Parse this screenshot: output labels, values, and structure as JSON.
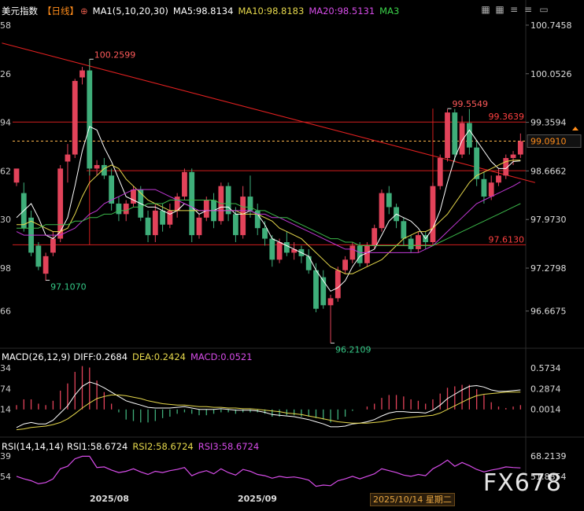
{
  "header": {
    "symbol": "美元指数",
    "period": "【日线】",
    "ma_label": "MA1(5,10,20,30)",
    "ma5": "MA5:98.8134",
    "ma10": "MA10:98.8183",
    "ma20": "MA20:98.5131",
    "ma3": "MA3"
  },
  "macd_header": {
    "label": "MACD(26,12,9)",
    "diff": "DIFF:0.2684",
    "dea": "DEA:0.2424",
    "macd": "MACD:0.0521"
  },
  "rsi_header": {
    "label": "RSI(14,14,14)",
    "rsi1": "RSI1:58.6724",
    "rsi2": "RSI2:58.6724",
    "rsi3": "RSI3:58.6724"
  },
  "colors": {
    "up": "#e2435a",
    "down": "#3fae7a",
    "ma5": "#ffffff",
    "ma10": "#e6d84c",
    "ma20": "#c238d6",
    "ma30": "#3bb84a",
    "hline": "#d31e1e",
    "price": "#ffb84d"
  },
  "toolbar": {
    "icons": [
      "grid-icon",
      "grid-icon",
      "menu-icon",
      "menu-icon",
      "minimize-icon"
    ]
  },
  "watermark": "FX678",
  "x_labels": [
    "2025/08",
    "2025/09"
  ],
  "date_badge": "2025/10/14 星期二",
  "chart_data": {
    "type": "candlestick",
    "price_axis": {
      "ticks": [
        100.7458,
        100.0526,
        99.3594,
        98.6662,
        97.973,
        97.2798,
        96.6675
      ],
      "left_ticks": [
        "58",
        "26",
        "94",
        "62",
        "30",
        "98",
        "66"
      ],
      "ylim": [
        96.17,
        100.88
      ],
      "current_price": 99.091,
      "current_label": "99.0910",
      "markers": [
        "99.3639",
        "97.6130"
      ],
      "marker_values": [
        99.3639,
        97.613
      ],
      "extra_line": 98.67
    },
    "annotations": [
      {
        "label": "100.2599",
        "bar": 10,
        "price": 100.2599
      },
      {
        "label": "97.1070",
        "bar": 4,
        "price": 97.107
      },
      {
        "label": "96.2109",
        "bar": 43,
        "price": 96.2109
      },
      {
        "label": "99.5549",
        "bar": 59,
        "price": 99.5549
      }
    ],
    "trendline": [
      {
        "bar": -2,
        "price": 100.49
      },
      {
        "bar": 71,
        "price": 98.5
      }
    ],
    "candles": [
      {
        "o": 98.5,
        "h": 98.68,
        "c": 98.7,
        "l": 98.45
      },
      {
        "o": 98.35,
        "h": 98.5,
        "c": 97.85,
        "l": 97.8
      },
      {
        "o": 98.0,
        "h": 98.1,
        "c": 97.5,
        "l": 97.45
      },
      {
        "o": 97.6,
        "h": 97.65,
        "c": 97.3,
        "l": 97.25
      },
      {
        "o": 97.2,
        "h": 97.5,
        "c": 97.45,
        "l": 97.1
      },
      {
        "o": 97.5,
        "h": 97.8,
        "c": 97.7,
        "l": 97.45
      },
      {
        "o": 97.7,
        "h": 98.75,
        "c": 98.7,
        "l": 97.65
      },
      {
        "o": 98.8,
        "h": 99.05,
        "c": 98.9,
        "l": 98.5
      },
      {
        "o": 98.9,
        "h": 99.98,
        "c": 99.95,
        "l": 98.85
      },
      {
        "o": 100.0,
        "h": 100.15,
        "c": 100.1,
        "l": 99.9
      },
      {
        "o": 100.1,
        "h": 100.26,
        "c": 98.7,
        "l": 98.6
      },
      {
        "o": 98.7,
        "h": 98.82,
        "c": 98.75,
        "l": 98.6
      },
      {
        "o": 98.75,
        "h": 98.85,
        "c": 98.6,
        "l": 98.55
      },
      {
        "o": 98.6,
        "h": 98.7,
        "c": 98.2,
        "l": 98.1
      },
      {
        "o": 98.2,
        "h": 98.3,
        "c": 98.05,
        "l": 97.95
      },
      {
        "o": 98.05,
        "h": 98.25,
        "c": 98.2,
        "l": 97.95
      },
      {
        "o": 98.2,
        "h": 98.45,
        "c": 98.4,
        "l": 98.15
      },
      {
        "o": 98.4,
        "h": 98.45,
        "c": 98.0,
        "l": 97.95
      },
      {
        "o": 98.0,
        "h": 98.1,
        "c": 97.75,
        "l": 97.65
      },
      {
        "o": 97.75,
        "h": 98.2,
        "c": 98.1,
        "l": 97.65
      },
      {
        "o": 98.1,
        "h": 98.2,
        "c": 97.9,
        "l": 97.8
      },
      {
        "o": 97.9,
        "h": 98.2,
        "c": 98.1,
        "l": 97.85
      },
      {
        "o": 98.1,
        "h": 98.35,
        "c": 98.3,
        "l": 98.0
      },
      {
        "o": 98.3,
        "h": 98.7,
        "c": 98.65,
        "l": 98.25
      },
      {
        "o": 98.65,
        "h": 98.7,
        "c": 97.75,
        "l": 97.65
      },
      {
        "o": 97.75,
        "h": 98.05,
        "c": 98.0,
        "l": 97.7
      },
      {
        "o": 98.0,
        "h": 98.3,
        "c": 98.25,
        "l": 97.95
      },
      {
        "o": 98.25,
        "h": 98.35,
        "c": 97.95,
        "l": 97.85
      },
      {
        "o": 97.95,
        "h": 98.5,
        "c": 98.45,
        "l": 97.9
      },
      {
        "o": 98.45,
        "h": 98.5,
        "c": 98.05,
        "l": 97.95
      },
      {
        "o": 98.05,
        "h": 98.15,
        "c": 97.75,
        "l": 97.65
      },
      {
        "o": 97.75,
        "h": 98.45,
        "c": 98.3,
        "l": 97.7
      },
      {
        "o": 98.3,
        "h": 98.6,
        "c": 98.1,
        "l": 98.0
      },
      {
        "o": 98.1,
        "h": 98.2,
        "c": 97.85,
        "l": 97.75
      },
      {
        "o": 97.85,
        "h": 97.95,
        "c": 97.7,
        "l": 97.6
      },
      {
        "o": 97.7,
        "h": 97.75,
        "c": 97.4,
        "l": 97.3
      },
      {
        "o": 97.4,
        "h": 97.7,
        "c": 97.65,
        "l": 97.35
      },
      {
        "o": 97.65,
        "h": 97.8,
        "c": 97.5,
        "l": 97.45
      },
      {
        "o": 97.5,
        "h": 97.65,
        "c": 97.55,
        "l": 97.4
      },
      {
        "o": 97.55,
        "h": 97.6,
        "c": 97.45,
        "l": 97.35
      },
      {
        "o": 97.45,
        "h": 97.55,
        "c": 97.25,
        "l": 97.2
      },
      {
        "o": 97.25,
        "h": 97.35,
        "c": 96.7,
        "l": 96.65
      },
      {
        "o": 97.15,
        "h": 97.25,
        "c": 96.75,
        "l": 96.7
      },
      {
        "o": 96.75,
        "h": 96.9,
        "c": 96.85,
        "l": 96.21
      },
      {
        "o": 96.85,
        "h": 97.3,
        "c": 97.25,
        "l": 96.8
      },
      {
        "o": 97.25,
        "h": 97.45,
        "c": 97.4,
        "l": 97.2
      },
      {
        "o": 97.4,
        "h": 97.65,
        "c": 97.6,
        "l": 97.35
      },
      {
        "o": 97.6,
        "h": 97.65,
        "c": 97.35,
        "l": 97.3
      },
      {
        "o": 97.35,
        "h": 97.65,
        "c": 97.6,
        "l": 97.3
      },
      {
        "o": 97.6,
        "h": 97.9,
        "c": 97.85,
        "l": 97.55
      },
      {
        "o": 97.85,
        "h": 98.4,
        "c": 98.35,
        "l": 97.8
      },
      {
        "o": 98.35,
        "h": 98.45,
        "c": 98.15,
        "l": 98.05
      },
      {
        "o": 98.15,
        "h": 98.2,
        "c": 97.95,
        "l": 97.85
      },
      {
        "o": 97.95,
        "h": 98.0,
        "c": 97.7,
        "l": 97.6
      },
      {
        "o": 97.7,
        "h": 97.75,
        "c": 97.55,
        "l": 97.5
      },
      {
        "o": 97.55,
        "h": 97.8,
        "c": 97.75,
        "l": 97.5
      },
      {
        "o": 97.75,
        "h": 97.8,
        "c": 97.65,
        "l": 97.55
      },
      {
        "o": 97.65,
        "h": 98.5,
        "c": 98.45,
        "l": 97.6
      },
      {
        "o": 98.45,
        "h": 98.9,
        "c": 98.85,
        "l": 98.4
      },
      {
        "o": 98.85,
        "h": 99.55,
        "c": 99.5,
        "l": 98.8
      },
      {
        "o": 99.5,
        "h": 99.55,
        "c": 98.9,
        "l": 98.8
      },
      {
        "o": 98.9,
        "h": 99.45,
        "c": 99.35,
        "l": 98.85
      },
      {
        "o": 99.35,
        "h": 99.55,
        "c": 99.0,
        "l": 98.9
      },
      {
        "o": 99.0,
        "h": 99.1,
        "c": 98.55,
        "l": 98.45
      },
      {
        "o": 98.55,
        "h": 98.65,
        "c": 98.3,
        "l": 98.2
      },
      {
        "o": 98.3,
        "h": 98.6,
        "c": 98.5,
        "l": 98.25
      },
      {
        "o": 98.5,
        "h": 98.7,
        "c": 98.6,
        "l": 98.45
      },
      {
        "o": 98.6,
        "h": 98.9,
        "c": 98.85,
        "l": 98.55
      },
      {
        "o": 98.85,
        "h": 98.95,
        "c": 98.9,
        "l": 98.75
      },
      {
        "o": 98.9,
        "h": 99.2,
        "c": 99.09,
        "l": 98.85
      }
    ],
    "ma_series": [
      {
        "name": "MA5",
        "values": [
          98.0,
          98.1,
          98.2,
          98.0,
          97.75,
          97.7,
          97.8,
          98.0,
          98.45,
          98.95,
          99.3,
          99.25,
          99.0,
          98.8,
          98.55,
          98.3,
          98.25,
          98.2,
          98.15,
          98.15,
          98.1,
          98.05,
          98.1,
          98.2,
          98.15,
          98.05,
          98.1,
          98.1,
          98.15,
          98.15,
          98.05,
          98.05,
          98.1,
          98.05,
          97.9,
          97.7,
          97.65,
          97.6,
          97.55,
          97.5,
          97.45,
          97.25,
          97.1,
          96.95,
          97.0,
          97.1,
          97.3,
          97.45,
          97.5,
          97.55,
          97.75,
          97.95,
          98.05,
          98.0,
          97.95,
          97.85,
          97.7,
          97.85,
          98.1,
          98.5,
          98.85,
          99.1,
          99.25,
          99.1,
          98.95,
          98.8,
          98.7,
          98.7,
          98.8,
          98.81
        ]
      },
      {
        "name": "MA10",
        "values": [
          97.9,
          97.9,
          97.95,
          97.9,
          97.85,
          97.8,
          97.8,
          97.85,
          98.05,
          98.3,
          98.5,
          98.6,
          98.7,
          98.75,
          98.7,
          98.55,
          98.45,
          98.35,
          98.25,
          98.2,
          98.15,
          98.1,
          98.1,
          98.1,
          98.1,
          98.1,
          98.1,
          98.1,
          98.1,
          98.1,
          98.1,
          98.05,
          98.05,
          98.05,
          98.0,
          97.95,
          97.85,
          97.8,
          97.75,
          97.7,
          97.6,
          97.5,
          97.4,
          97.3,
          97.25,
          97.2,
          97.2,
          97.25,
          97.3,
          97.35,
          97.4,
          97.5,
          97.6,
          97.7,
          97.75,
          97.8,
          97.8,
          97.85,
          97.95,
          98.05,
          98.2,
          98.35,
          98.5,
          98.6,
          98.65,
          98.7,
          98.75,
          98.8,
          98.82,
          98.82
        ]
      },
      {
        "name": "MA20",
        "values": [
          97.8,
          97.75,
          97.75,
          97.75,
          97.75,
          97.75,
          97.75,
          97.8,
          97.85,
          97.95,
          98.05,
          98.1,
          98.2,
          98.25,
          98.3,
          98.35,
          98.4,
          98.4,
          98.4,
          98.4,
          98.35,
          98.3,
          98.25,
          98.2,
          98.15,
          98.1,
          98.1,
          98.1,
          98.1,
          98.1,
          98.1,
          98.1,
          98.1,
          98.05,
          98.05,
          98.0,
          98.0,
          97.95,
          97.9,
          97.85,
          97.8,
          97.75,
          97.7,
          97.65,
          97.6,
          97.55,
          97.55,
          97.5,
          97.5,
          97.5,
          97.5,
          97.5,
          97.5,
          97.5,
          97.5,
          97.5,
          97.55,
          97.6,
          97.7,
          97.8,
          97.9,
          98.0,
          98.1,
          98.2,
          98.25,
          98.3,
          98.35,
          98.4,
          98.45,
          98.51
        ]
      },
      {
        "name": "MA30",
        "values": [
          97.85,
          97.85,
          97.85,
          97.85,
          97.9,
          97.9,
          97.9,
          97.9,
          97.95,
          97.95,
          98.0,
          98.0,
          98.05,
          98.05,
          98.1,
          98.1,
          98.15,
          98.15,
          98.2,
          98.2,
          98.2,
          98.25,
          98.25,
          98.25,
          98.25,
          98.25,
          98.25,
          98.25,
          98.2,
          98.2,
          98.2,
          98.15,
          98.15,
          98.1,
          98.1,
          98.05,
          98.0,
          98.0,
          97.95,
          97.9,
          97.85,
          97.8,
          97.75,
          97.7,
          97.7,
          97.65,
          97.65,
          97.6,
          97.6,
          97.6,
          97.6,
          97.6,
          97.6,
          97.6,
          97.6,
          97.6,
          97.6,
          97.6,
          97.65,
          97.7,
          97.75,
          97.8,
          97.85,
          97.9,
          97.95,
          98.0,
          98.05,
          98.1,
          98.15,
          98.2
        ]
      }
    ],
    "macd": {
      "ticks": [
        0.5734,
        0.2874,
        0.0014
      ],
      "left_ticks": [
        "34",
        "74",
        "14"
      ],
      "ylim": [
        -0.35,
        0.64
      ],
      "diff": [
        -0.25,
        -0.2,
        -0.18,
        -0.2,
        -0.2,
        -0.15,
        -0.05,
        0.05,
        0.2,
        0.32,
        0.38,
        0.35,
        0.3,
        0.24,
        0.18,
        0.12,
        0.09,
        0.06,
        0.03,
        0.02,
        0.02,
        0.02,
        0.03,
        0.04,
        0.02,
        0.0,
        0.0,
        0.0,
        0.01,
        0.0,
        -0.01,
        -0.01,
        -0.01,
        -0.02,
        -0.04,
        -0.07,
        -0.08,
        -0.09,
        -0.1,
        -0.12,
        -0.14,
        -0.17,
        -0.2,
        -0.24,
        -0.24,
        -0.23,
        -0.2,
        -0.19,
        -0.17,
        -0.14,
        -0.09,
        -0.05,
        -0.03,
        -0.03,
        -0.04,
        -0.04,
        -0.05,
        -0.01,
        0.06,
        0.15,
        0.21,
        0.27,
        0.32,
        0.33,
        0.31,
        0.27,
        0.25,
        0.25,
        0.26,
        0.27
      ],
      "dea": [
        -0.28,
        -0.27,
        -0.25,
        -0.24,
        -0.23,
        -0.21,
        -0.18,
        -0.13,
        -0.06,
        0.02,
        0.09,
        0.15,
        0.18,
        0.2,
        0.2,
        0.19,
        0.17,
        0.15,
        0.12,
        0.1,
        0.08,
        0.07,
        0.06,
        0.06,
        0.05,
        0.04,
        0.04,
        0.03,
        0.03,
        0.02,
        0.02,
        0.01,
        0.01,
        0.0,
        -0.01,
        -0.02,
        -0.03,
        -0.05,
        -0.06,
        -0.07,
        -0.09,
        -0.11,
        -0.13,
        -0.15,
        -0.17,
        -0.18,
        -0.19,
        -0.19,
        -0.19,
        -0.18,
        -0.17,
        -0.15,
        -0.13,
        -0.12,
        -0.11,
        -0.1,
        -0.09,
        -0.08,
        -0.05,
        0.0,
        0.05,
        0.1,
        0.15,
        0.19,
        0.21,
        0.22,
        0.23,
        0.24,
        0.24,
        0.24
      ]
    },
    "rsi": {
      "ticks": [
        68.2139,
        51.8854
      ],
      "left_ticks": [
        "39",
        "54"
      ],
      "ylim": [
        40,
        72
      ],
      "values": [
        52.0,
        50.0,
        48.5,
        46.0,
        47.0,
        50.0,
        58.0,
        60.0,
        66.0,
        68.0,
        68.0,
        59.0,
        59.5,
        57.0,
        55.0,
        56.0,
        58.0,
        55.5,
        53.5,
        56.0,
        55.0,
        56.5,
        57.5,
        59.0,
        52.5,
        55.0,
        56.5,
        54.0,
        58.0,
        55.0,
        53.0,
        57.5,
        56.0,
        53.5,
        52.5,
        50.5,
        52.0,
        51.0,
        51.5,
        50.5,
        49.0,
        44.0,
        45.0,
        44.5,
        48.5,
        50.0,
        52.0,
        50.0,
        52.0,
        54.0,
        58.0,
        56.5,
        55.0,
        53.0,
        52.0,
        53.5,
        52.5,
        58.0,
        61.0,
        65.0,
        60.0,
        63.0,
        60.5,
        57.5,
        55.5,
        57.0,
        58.0,
        59.5,
        59.0,
        58.67
      ]
    }
  }
}
